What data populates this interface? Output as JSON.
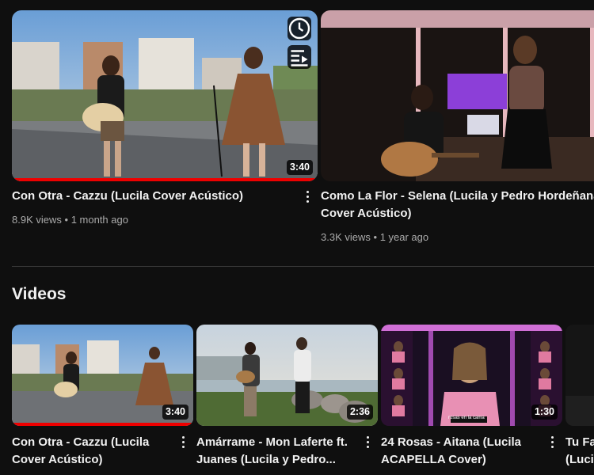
{
  "featured": [
    {
      "title": "Con Otra - Cazzu (Lucila Cover Acústico)",
      "views": "8.9K views",
      "age": "1 month ago",
      "duration": "3:40"
    },
    {
      "title_line1": "Como La Flor - Selena (Lucila y Pedro Hordeñana",
      "title_line2": "Cover Acústico)",
      "views": "3.3K views",
      "age": "1 year ago"
    }
  ],
  "meta_separator": "•",
  "hover_icons": [
    "clock-icon",
    "add-to-queue-icon"
  ],
  "section": {
    "title": "Videos"
  },
  "videos": [
    {
      "title_line1": "Con Otra - Cazzu (Lucila",
      "title_line2": "Cover Acústico)",
      "duration": "3:40"
    },
    {
      "title_line1": "Amárrame - Mon Laferte ft.",
      "title_line2": "Juanes (Lucila y Pedro...",
      "duration": "2:36"
    },
    {
      "title_line1": "24 Rosas - Aitana (Lucila",
      "title_line2": "ACAPELLA Cover)",
      "duration": "1:30",
      "overlay_text": "rosas en la cama"
    },
    {
      "title_line1": "Tu Fa",
      "title_line2": "(Luci"
    }
  ],
  "colors": {
    "background": "#0f0f0f",
    "text": "#f1f1f1",
    "secondary_text": "#aaaaaa",
    "progress": "#ee0000"
  }
}
